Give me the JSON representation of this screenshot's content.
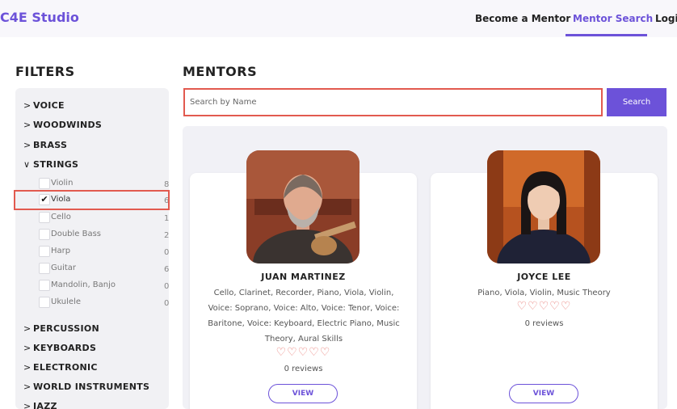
{
  "header": {
    "brand": "C4E Studio",
    "nav": {
      "become_mentor": "Become a Mentor",
      "mentor_search": "Mentor Search",
      "login": "Login"
    },
    "accent_color": "#6c52d9"
  },
  "filters": {
    "heading": "FILTERS",
    "categories": {
      "voice": "VOICE",
      "woodwinds": "WOODWINDS",
      "brass": "BRASS",
      "strings": "STRINGS",
      "percussion": "PERCUSSION",
      "keyboards": "KEYBOARDS",
      "electronic": "ELECTRONIC",
      "world": "WORLD INSTRUMENTS",
      "jazz": "JAZZ"
    },
    "strings_expanded": true,
    "strings_options": [
      {
        "label": "Violin",
        "count": "8",
        "checked": false
      },
      {
        "label": "Viola",
        "count": "6",
        "checked": true
      },
      {
        "label": "Cello",
        "count": "1",
        "checked": false
      },
      {
        "label": "Double Bass",
        "count": "2",
        "checked": false
      },
      {
        "label": "Harp",
        "count": "0",
        "checked": false
      },
      {
        "label": "Guitar",
        "count": "6",
        "checked": false
      },
      {
        "label": "Mandolin, Banjo",
        "count": "0",
        "checked": false
      },
      {
        "label": "Ukulele",
        "count": "0",
        "checked": false
      }
    ],
    "chevron_collapsed": ">",
    "chevron_expanded": "∨",
    "check_mark": "✔"
  },
  "mentors": {
    "heading": "MENTORS",
    "search": {
      "placeholder": "Search by Name",
      "value": "",
      "button_label": "Search"
    },
    "cards": [
      {
        "name": "JUAN MARTINEZ",
        "skills": "Cello, Clarinet, Recorder, Piano, Viola, Violin, Voice: Soprano, Voice: Alto, Voice: Tenor, Voice: Baritone, Voice: Keyboard, Electric Piano, Music Theory, Aural Skills",
        "hearts": "♡♡♡♡♡",
        "rating_filled": 0,
        "rating_max": 5,
        "reviews": "0 reviews",
        "view_label": "VIEW"
      },
      {
        "name": "JOYCE LEE",
        "skills": "Piano, Viola, Violin, Music Theory",
        "hearts": "♡♡♡♡♡",
        "rating_filled": 0,
        "rating_max": 5,
        "reviews": "0 reviews",
        "view_label": "VIEW"
      }
    ],
    "heart_color": "#e87a74"
  }
}
